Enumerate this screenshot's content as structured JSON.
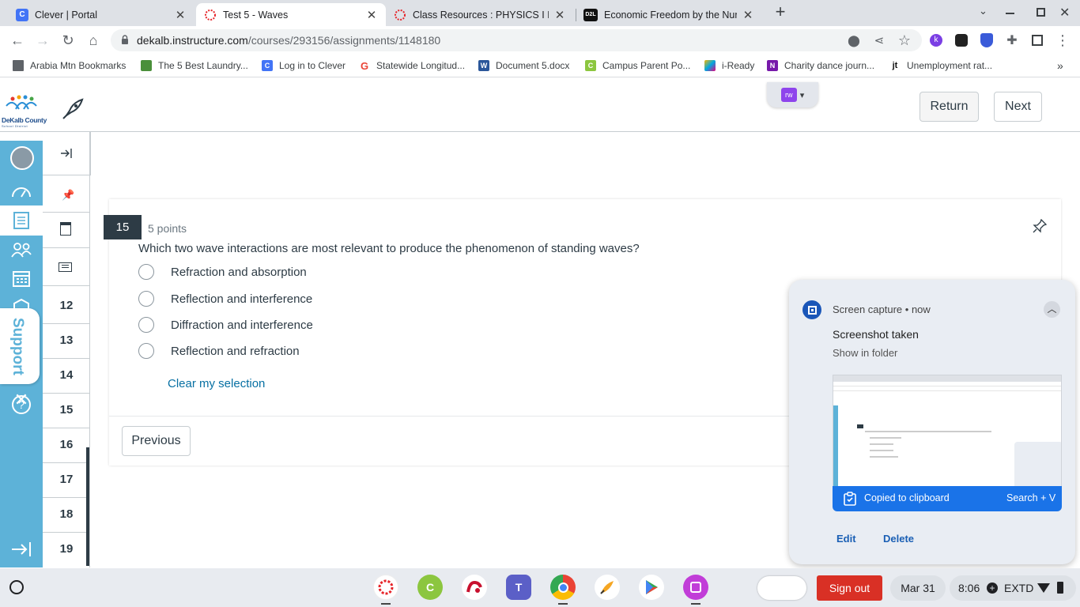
{
  "browser": {
    "tabs": [
      {
        "title": "Clever | Portal",
        "icon": "clever-icon"
      },
      {
        "title": "Test 5 - Waves",
        "icon": "canvas-icon",
        "active": true
      },
      {
        "title": "Class Resources : PHYSICS I B-M",
        "icon": "canvas-icon"
      },
      {
        "title": "Economic Freedom by the Numb",
        "icon": "d2l-icon"
      }
    ],
    "new_tab_label": "+",
    "url_domain": "dekalb.instructure.com",
    "url_path": "/courses/293156/assignments/1148180",
    "bookmarks": [
      "Arabia Mtn Bookmarks",
      "The 5 Best Laundry...",
      "Log in to Clever",
      "Statewide Longitud...",
      "Document 5.docx",
      "Campus Parent Po...",
      "i-Ready",
      "Charity dance journ...",
      "Unemployment rat..."
    ],
    "bookmark_icon_letters": [
      "",
      "",
      "C",
      "G",
      "W",
      "C",
      "",
      "N",
      "jt"
    ]
  },
  "header": {
    "logo_text": "DeKalb County",
    "logo_subtext": "School District",
    "extension_label": "rw",
    "return_label": "Return",
    "next_label": "Next"
  },
  "sidebar": {
    "support_label": "Support",
    "question_numbers": [
      "12",
      "13",
      "14",
      "15",
      "16",
      "17",
      "18",
      "19"
    ]
  },
  "question": {
    "number": "15",
    "points": "5 points",
    "text": "Which two wave interactions are most relevant to produce the phenomenon of standing waves?",
    "options": [
      "Refraction and absorption",
      "Reflection and interference",
      "Diffraction and interference",
      "Reflection and refraction"
    ],
    "clear_label": "Clear my selection",
    "previous_label": "Previous"
  },
  "notification": {
    "source": "Screen capture",
    "time": "now",
    "title": "Screenshot taken",
    "subtitle": "Show in folder",
    "clipboard_text": "Copied to clipboard",
    "shortcut": "Search + V",
    "edit_label": "Edit",
    "delete_label": "Delete"
  },
  "shelf": {
    "sign_out_label": "Sign out",
    "date": "Mar 31",
    "time": "8:06",
    "extd_label": "EXTD"
  },
  "colors": {
    "canvas_nav": "#5db2d8",
    "link": "#0770a3",
    "notification_blue": "#1a73e8",
    "sign_out_red": "#d93025"
  }
}
